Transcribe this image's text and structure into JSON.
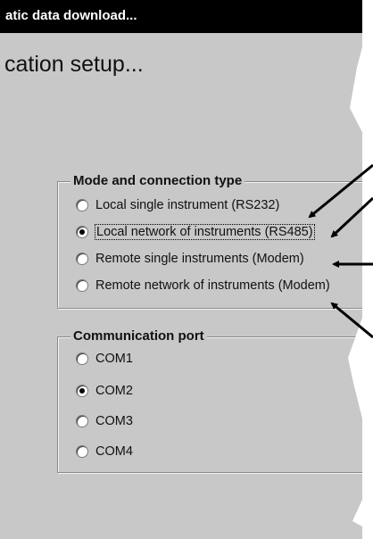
{
  "window": {
    "title": "atic data download...",
    "heading": "cation setup..."
  },
  "mode_group": {
    "legend": "Mode and connection type",
    "options": [
      {
        "label": "Local single instrument (RS232)",
        "checked": false
      },
      {
        "label": "Local network of instruments (RS485)",
        "checked": true
      },
      {
        "label": "Remote single instruments (Modem)",
        "checked": false
      },
      {
        "label": "Remote network of instruments (Modem)",
        "checked": false
      }
    ]
  },
  "port_group": {
    "legend": "Communication port",
    "options": [
      {
        "label": "COM1",
        "checked": false
      },
      {
        "label": "COM2",
        "checked": true
      },
      {
        "label": "COM3",
        "checked": false
      },
      {
        "label": "COM4",
        "checked": false
      }
    ]
  }
}
